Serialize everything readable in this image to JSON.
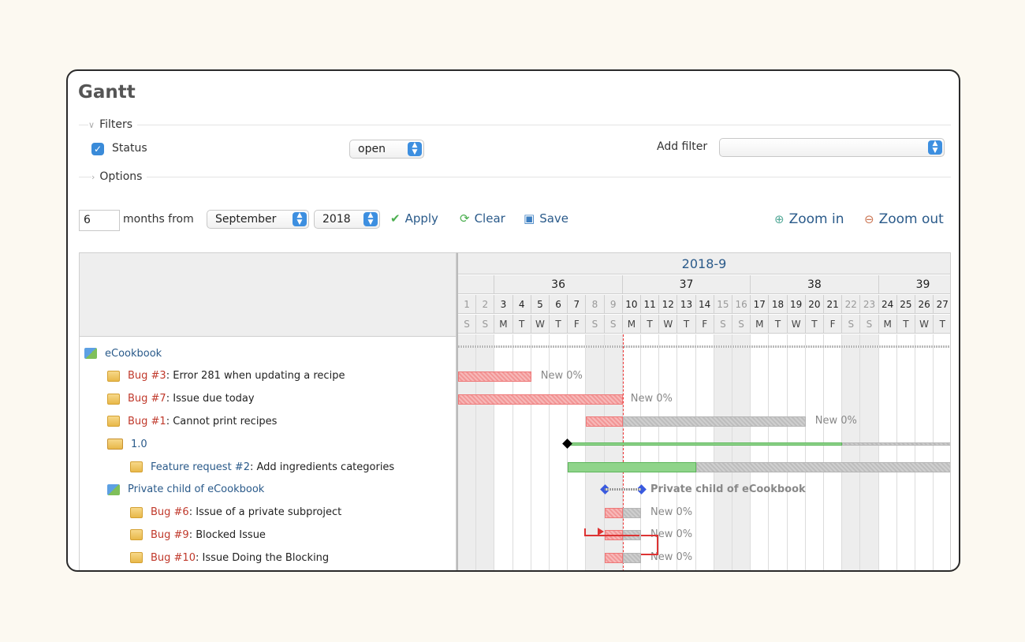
{
  "title": "Gantt",
  "filters": {
    "legend": "Filters",
    "status_label": "Status",
    "status_value": "open",
    "add_filter_label": "Add filter",
    "add_filter_value": ""
  },
  "options": {
    "legend": "Options"
  },
  "toolbar": {
    "months": "6",
    "months_from_label": "months from",
    "month": "September",
    "year": "2018",
    "apply": "Apply",
    "clear": "Clear",
    "save": "Save",
    "zoom_in": "Zoom in",
    "zoom_out": "Zoom out"
  },
  "gantt": {
    "month_header": "2018-9",
    "weeks": [
      "36",
      "37",
      "38",
      "39"
    ],
    "days": [
      "1",
      "2",
      "3",
      "4",
      "5",
      "6",
      "7",
      "8",
      "9",
      "10",
      "11",
      "12",
      "13",
      "14",
      "15",
      "16",
      "17",
      "18",
      "19",
      "20",
      "21",
      "22",
      "23",
      "24",
      "25",
      "26",
      "27"
    ],
    "day_names": [
      "S",
      "S",
      "M",
      "T",
      "W",
      "T",
      "F",
      "S",
      "S",
      "M",
      "T",
      "W",
      "T",
      "F",
      "S",
      "S",
      "M",
      "T",
      "W",
      "T",
      "F",
      "S",
      "S",
      "M",
      "T",
      "W",
      "T"
    ],
    "tree": [
      {
        "kind": "project",
        "indent": 0,
        "link": "eCookbook",
        "text": ""
      },
      {
        "kind": "issue",
        "indent": 1,
        "link": "Bug #3",
        "text": ": Error 281 when updating a recipe",
        "linkClass": "link-bug"
      },
      {
        "kind": "issue",
        "indent": 1,
        "link": "Bug #7",
        "text": ": Issue due today",
        "linkClass": "link-bug"
      },
      {
        "kind": "issue",
        "indent": 1,
        "link": "Bug #1",
        "text": ": Cannot print recipes",
        "linkClass": "link-bug"
      },
      {
        "kind": "version",
        "indent": 1,
        "link": "1.0",
        "text": ""
      },
      {
        "kind": "issue",
        "indent": 2,
        "link": "Feature request #2",
        "text": ": Add ingredients categories",
        "linkClass": "link-feat"
      },
      {
        "kind": "project",
        "indent": 1,
        "link": "Private child of eCookbook",
        "text": ""
      },
      {
        "kind": "issue",
        "indent": 2,
        "link": "Bug #6",
        "text": ": Issue of a private subproject",
        "linkClass": "link-bug"
      },
      {
        "kind": "issue",
        "indent": 2,
        "link": "Bug #9",
        "text": ": Blocked Issue",
        "linkClass": "link-bug"
      },
      {
        "kind": "issue",
        "indent": 2,
        "link": "Bug #10",
        "text": ": Issue Doing the Blocking",
        "linkClass": "link-bug"
      }
    ],
    "bar_labels": {
      "bug3": "New 0%",
      "bug7": "New 0%",
      "bug1": "New 0%",
      "private": "Private child of eCookbook",
      "bug6": "New 0%",
      "bug9": "New 0%",
      "bug10": "New 0%"
    }
  }
}
